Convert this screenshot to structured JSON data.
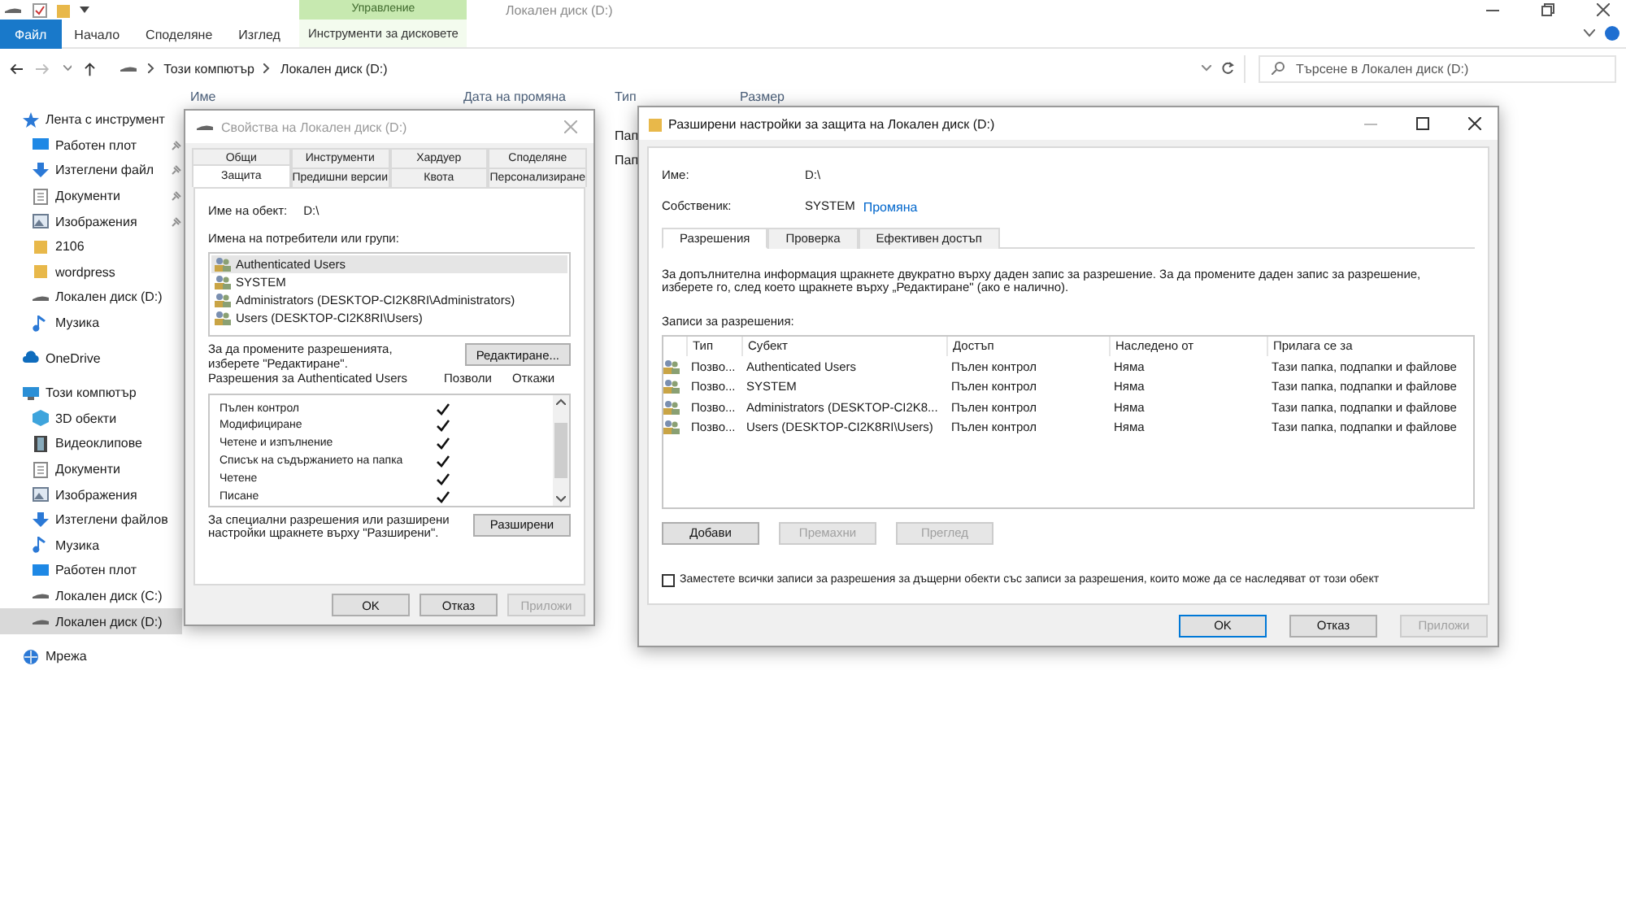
{
  "explorer": {
    "title": "Локален диск (D:)",
    "context_group": "Управление",
    "ribbon_tabs": [
      {
        "label": "Файл",
        "kind": "file"
      },
      {
        "label": "Начало",
        "kind": "tab"
      },
      {
        "label": "Споделяне",
        "kind": "tab"
      },
      {
        "label": "Изглед",
        "kind": "tab"
      },
      {
        "label": "Инструменти за дисковете",
        "kind": "context"
      }
    ],
    "path": [
      "Този компютър",
      "Локален диск (D:)"
    ],
    "search": {
      "placeholder": "Търсене в Локален диск (D:)"
    },
    "columns": [
      "Име",
      "Дата на промяна",
      "Тип",
      "Размер"
    ],
    "rows": [
      {
        "type": "Пап"
      },
      {
        "type": "Пап"
      }
    ],
    "nav": [
      {
        "label": "Лента с инструмент",
        "kind": "star",
        "selected": false,
        "children": [
          {
            "label": "Работен плот",
            "kind": "desktop",
            "pinned": true,
            "selected": false
          },
          {
            "label": "Изтеглени файл",
            "kind": "download",
            "pinned": true,
            "selected": false
          },
          {
            "label": "Документи",
            "kind": "document",
            "pinned": true,
            "selected": false
          },
          {
            "label": "Изображения",
            "kind": "pictures",
            "pinned": true,
            "selected": false
          },
          {
            "label": "2106",
            "kind": "folder",
            "pinned": false,
            "selected": false
          },
          {
            "label": "wordpress",
            "kind": "folder",
            "pinned": false,
            "selected": false
          },
          {
            "label": "Локален диск (D:)",
            "kind": "drive",
            "pinned": false,
            "selected": false
          },
          {
            "label": "Музика",
            "kind": "music",
            "pinned": false,
            "selected": false
          }
        ]
      },
      {
        "label": "OneDrive",
        "kind": "cloud",
        "selected": false
      },
      {
        "label": "Този компютър",
        "kind": "computer",
        "selected": false,
        "children": [
          {
            "label": "3D обекти",
            "kind": "cube",
            "selected": false
          },
          {
            "label": "Видеоклипове",
            "kind": "video",
            "selected": false
          },
          {
            "label": "Документи",
            "kind": "document",
            "selected": false
          },
          {
            "label": "Изображения",
            "kind": "pictures",
            "selected": false
          },
          {
            "label": "Изтеглени файлов",
            "kind": "download",
            "selected": false
          },
          {
            "label": "Музика",
            "kind": "music",
            "selected": false
          },
          {
            "label": "Работен плот",
            "kind": "desktop",
            "selected": false
          },
          {
            "label": "Локален диск (C:)",
            "kind": "drive",
            "selected": false
          },
          {
            "label": "Локален диск (D:)",
            "kind": "drive",
            "selected": true
          }
        ]
      },
      {
        "label": "Мрежа",
        "kind": "network",
        "selected": false
      }
    ]
  },
  "properties_dialog": {
    "title": "Свойства на Локален диск (D:)",
    "tab_rows": [
      [
        {
          "label": "Общи",
          "selected": false
        },
        {
          "label": "Инструменти",
          "selected": false
        },
        {
          "label": "Хардуер",
          "selected": false
        },
        {
          "label": "Споделяне",
          "selected": false
        }
      ],
      [
        {
          "label": "Защита",
          "selected": true
        },
        {
          "label": "Предишни версии",
          "selected": false
        },
        {
          "label": "Квота",
          "selected": false
        },
        {
          "label": "Персонализиране",
          "selected": false
        }
      ]
    ],
    "object_label": "Име на обект:",
    "object_value": "D:\\",
    "groups_label": "Имена на потребители или групи:",
    "groups": [
      {
        "name": "Authenticated Users",
        "selected": true
      },
      {
        "name": "SYSTEM",
        "selected": false
      },
      {
        "name": "Administrators (DESKTOP-CI2K8RI\\Administrators)",
        "selected": false
      },
      {
        "name": "Users (DESKTOP-CI2K8RI\\Users)",
        "selected": false
      }
    ],
    "edit_hint": "За да промените разрешенията, изберете \"Редактиране\".",
    "edit_button": "Редактиране...",
    "permissions_label": "Разрешения за Authenticated Users",
    "allow_header": "Позволи",
    "deny_header": "Откажи",
    "permissions": [
      {
        "name": "Пълен контрол",
        "allow": true,
        "deny": false
      },
      {
        "name": "Модифициране",
        "allow": true,
        "deny": false
      },
      {
        "name": "Четене и изпълнение",
        "allow": true,
        "deny": false
      },
      {
        "name": "Списък на съдържанието на папка",
        "allow": true,
        "deny": false
      },
      {
        "name": "Четене",
        "allow": true,
        "deny": false
      },
      {
        "name": "Писане",
        "allow": true,
        "deny": false
      }
    ],
    "advanced_hint": "За специални разрешения или разширени настройки щракнете върху \"Разширени\".",
    "advanced_button": "Разширени",
    "buttons": [
      {
        "label": "OK",
        "disabled": false
      },
      {
        "label": "Отказ",
        "disabled": false
      },
      {
        "label": "Приложи",
        "disabled": true
      }
    ]
  },
  "advanced_dialog": {
    "title": "Разширени настройки за защита на Локален диск (D:)",
    "name_label": "Име:",
    "name_value": "D:\\",
    "owner_label": "Собственик:",
    "owner_value": "SYSTEM",
    "owner_link": "Промяна",
    "tabs": [
      {
        "label": "Разрешения",
        "selected": true
      },
      {
        "label": "Проверка",
        "selected": false
      },
      {
        "label": "Ефективен достъп",
        "selected": false
      }
    ],
    "info": "За допълнителна информация щракнете двукратно върху даден запис за разрешение. За да промените даден запис за разрешение, изберете го, след което щракнете върху „Редактиране\" (ако е налично).",
    "entries_label": "Записи за разрешения:",
    "columns": [
      "Тип",
      "Субект",
      "Достъп",
      "Наследено от",
      "Прилага се за"
    ],
    "entries": [
      [
        "Позво...",
        "Authenticated Users",
        "Пълен контрол",
        "Няма",
        "Тази папка, подпапки и файлове"
      ],
      [
        "Позво...",
        "SYSTEM",
        "Пълен контрол",
        "Няма",
        "Тази папка, подпапки и файлове"
      ],
      [
        "Позво...",
        "Administrators (DESKTOP-CI2K8...",
        "Пълен контрол",
        "Няма",
        "Тази папка, подпапки и файлове"
      ],
      [
        "Позво...",
        "Users (DESKTOP-CI2K8RI\\Users)",
        "Пълен контрол",
        "Няма",
        "Тази папка, подпапки и файлове"
      ]
    ],
    "entry_buttons": [
      {
        "label": "Добави",
        "disabled": false
      },
      {
        "label": "Премахни",
        "disabled": true
      },
      {
        "label": "Преглед",
        "disabled": true
      }
    ],
    "replace_checkbox": {
      "label": "Заместете всички записи за разрешения за дъщерни обекти със записи за разрешения, които може да се наследяват от този обект",
      "checked": false
    },
    "buttons": [
      {
        "label": "OK",
        "disabled": false,
        "default": true
      },
      {
        "label": "Отказ",
        "disabled": false,
        "default": false
      },
      {
        "label": "Приложи",
        "disabled": true,
        "default": false
      }
    ]
  }
}
